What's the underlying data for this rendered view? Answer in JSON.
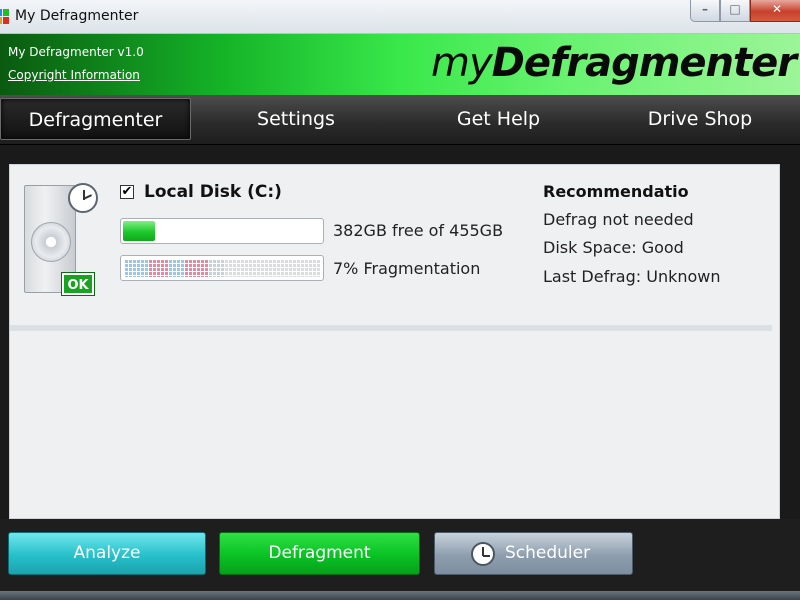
{
  "window": {
    "title": "My Defragmenter",
    "controls": {
      "minimize": "–",
      "maximize": "□",
      "close": "✕"
    }
  },
  "header": {
    "version": "My Defragmenter v1.0",
    "copyright_link": "Copyright Information",
    "logo_light": "my",
    "logo_bold": "Defragmenter"
  },
  "nav": {
    "tabs": [
      {
        "label": "Defragmenter",
        "active": true
      },
      {
        "label": "Settings",
        "active": false
      },
      {
        "label": "Get Help",
        "active": false
      },
      {
        "label": "Drive Shop",
        "active": false
      }
    ]
  },
  "disk": {
    "checked_glyph": "✔",
    "name": "Local Disk (C:)",
    "status_badge": "OK",
    "free_space_text": "382GB free of 455GB",
    "used_fraction": 0.16,
    "fragmentation_text": "7% Fragmentation"
  },
  "recommendation": {
    "title": "Recommendation",
    "lines": [
      "Defrag not needed",
      "Disk Space: Good",
      "Last Defrag: Unknown"
    ]
  },
  "actions": {
    "analyze": "Analyze",
    "defragment": "Defragment",
    "scheduler": "Scheduler"
  },
  "colors": {
    "header_green": "#39e84a",
    "nav_dark": "#2a2a2a",
    "analyze": "#26c0ca",
    "defragment": "#09c224",
    "scheduler": "#8e9eae",
    "ok_badge": "#1aa323"
  },
  "icons": {
    "app": "app-icon",
    "disk": "hard-drive-icon",
    "clock": "clock-icon"
  }
}
